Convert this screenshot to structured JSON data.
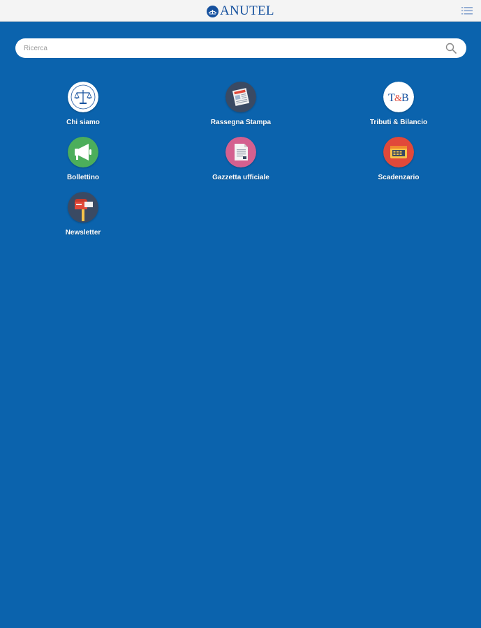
{
  "header": {
    "brand_name": "ANUTEL",
    "logo_icon": "anutel-logo-icon",
    "menu_icon": "list-menu-icon"
  },
  "search": {
    "placeholder": "Ricerca",
    "value": "",
    "icon": "search-icon"
  },
  "menu": {
    "items": [
      {
        "label": "Chi siamo",
        "icon": "scales-of-justice-icon",
        "color": "#ffffff"
      },
      {
        "label": "Rassegna Stampa",
        "icon": "newspaper-icon",
        "color": "#3a4a63"
      },
      {
        "label": "Tributi & Bilancio",
        "icon": "tb-logo-icon",
        "color": "#ffffff"
      },
      {
        "label": "Bollettino",
        "icon": "megaphone-icon",
        "color": "#4cae5b"
      },
      {
        "label": "Gazzetta ufficiale",
        "icon": "document-icon",
        "color": "#d4608f"
      },
      {
        "label": "Scadenzario",
        "icon": "calendar-icon",
        "color": "#e1493a"
      },
      {
        "label": "Newsletter",
        "icon": "mailbox-icon",
        "color": "#3a4a63"
      }
    ]
  },
  "colors": {
    "background": "#0b63ad",
    "header_background": "#f4f4f4",
    "brand": "#16519e"
  }
}
